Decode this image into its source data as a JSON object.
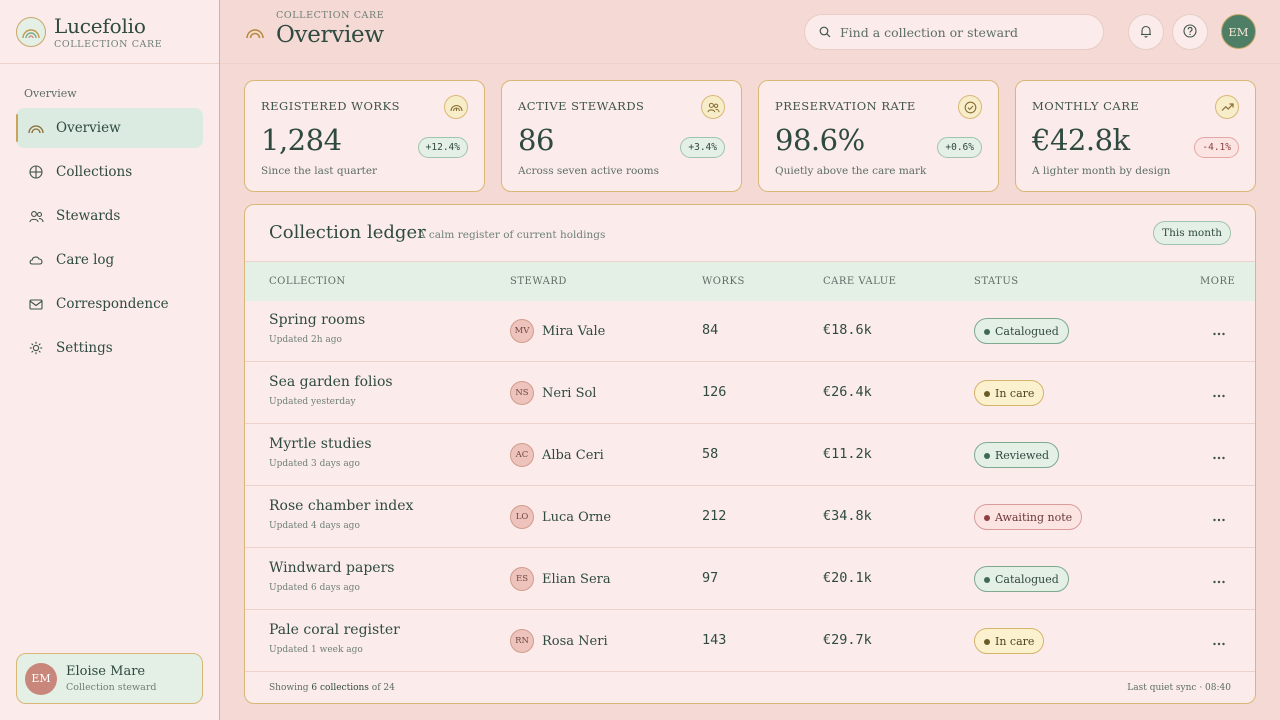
{
  "app": {
    "name": "Lucefolio",
    "subtitle": "COLLECTION CARE"
  },
  "sidebar": {
    "section": "Overview",
    "items": [
      {
        "label": "Overview",
        "icon": "rainbow-icon",
        "active": true
      },
      {
        "label": "Collections",
        "icon": "globe-icon"
      },
      {
        "label": "Stewards",
        "icon": "people-icon"
      },
      {
        "label": "Care log",
        "icon": "cloud-icon"
      },
      {
        "label": "Correspondence",
        "icon": "mail-icon"
      },
      {
        "label": "Settings",
        "icon": "gear-icon"
      }
    ],
    "user": {
      "initials": "EM",
      "name": "Eloise Mare",
      "role": "Collection steward"
    }
  },
  "header": {
    "kicker": "COLLECTION CARE",
    "title": "Overview",
    "search_placeholder": "Find a collection or steward",
    "avatar_initials": "EM"
  },
  "stats": [
    {
      "label": "REGISTERED WORKS",
      "value": "1,284",
      "delta": "+12.4%",
      "note": "Since the last quarter",
      "icon": "rainbow-icon",
      "negative": false
    },
    {
      "label": "ACTIVE STEWARDS",
      "value": "86",
      "delta": "+3.4%",
      "note": "Across seven active rooms",
      "icon": "people-icon",
      "negative": false
    },
    {
      "label": "PRESERVATION RATE",
      "value": "98.6%",
      "delta": "+0.6%",
      "note": "Quietly above the care mark",
      "icon": "check-circle-icon",
      "negative": false
    },
    {
      "label": "MONTHLY CARE",
      "value": "€42.8k",
      "delta": "-4.1%",
      "note": "A lighter month by design",
      "icon": "trend-up-icon",
      "negative": true
    }
  ],
  "ledger": {
    "title": "Collection ledger",
    "subtitle": "A calm register of current holdings",
    "filter": "This month",
    "columns": [
      "COLLECTION",
      "STEWARD",
      "WORKS",
      "CARE VALUE",
      "STATUS",
      "MORE"
    ],
    "rows": [
      {
        "name": "Spring rooms",
        "updated": "Updated 2h ago",
        "initials": "MV",
        "steward": "Mira Vale",
        "works": "84",
        "value": "€18.6k",
        "status": "Catalogued",
        "status_kind": "catalogued"
      },
      {
        "name": "Sea garden folios",
        "updated": "Updated yesterday",
        "initials": "NS",
        "steward": "Neri Sol",
        "works": "126",
        "value": "€26.4k",
        "status": "In care",
        "status_kind": "incare"
      },
      {
        "name": "Myrtle studies",
        "updated": "Updated 3 days ago",
        "initials": "AC",
        "steward": "Alba Ceri",
        "works": "58",
        "value": "€11.2k",
        "status": "Reviewed",
        "status_kind": "reviewed"
      },
      {
        "name": "Rose chamber index",
        "updated": "Updated 4 days ago",
        "initials": "LO",
        "steward": "Luca Orne",
        "works": "212",
        "value": "€34.8k",
        "status": "Awaiting note",
        "status_kind": "awaiting"
      },
      {
        "name": "Windward papers",
        "updated": "Updated 6 days ago",
        "initials": "ES",
        "steward": "Elian Sera",
        "works": "97",
        "value": "€20.1k",
        "status": "Catalogued",
        "status_kind": "catalogued"
      },
      {
        "name": "Pale coral register",
        "updated": "Updated 1 week ago",
        "initials": "RN",
        "steward": "Rosa Neri",
        "works": "143",
        "value": "€29.7k",
        "status": "In care",
        "status_kind": "incare"
      }
    ],
    "footer": {
      "prefix": "Showing",
      "count": "6 collections",
      "suffix": "of 24",
      "sync": "Last quiet sync · 08:40"
    }
  },
  "colors": {
    "accent_gold": "#d9b877",
    "sage": "#e4efe6",
    "forest": "#2f4a40",
    "rose_bg": "#f4d9d4"
  }
}
